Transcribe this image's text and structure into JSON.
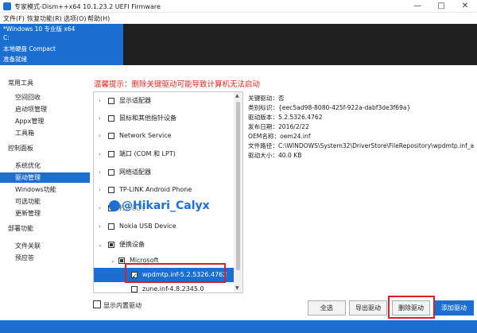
{
  "window": {
    "title": "专家模式-Dism++x64 10.1.23.2 UEFI Firmware",
    "minimize": "—",
    "maximize": "□",
    "close": "✕"
  },
  "menu": [
    "文件(F)",
    "恢复功能(R)",
    "选项(O)",
    "帮助(H)"
  ],
  "system": {
    "name": "*Windows 10 专业版 x64",
    "drive": "C:",
    "disk": "本地硬盘 Compact",
    "status": "准备就绪"
  },
  "sidebar": {
    "groups": [
      {
        "label": "常用工具",
        "items": [
          "空间回收",
          "启动项管理",
          "Appx管理",
          "工具箱"
        ]
      },
      {
        "label": "控制面板",
        "items": [
          "系统优化",
          "驱动管理",
          "Windows功能",
          "可选功能",
          "更新管理"
        ]
      },
      {
        "label": "部署功能",
        "items": [
          "文件关联",
          "预应答"
        ]
      }
    ],
    "active": "驱动管理"
  },
  "warning": "温馨提示：删除关键驱动可能导致计算机无法启动",
  "tree": [
    {
      "label": "显示适配器",
      "state": "none",
      "arrow": "›",
      "depth": 0
    },
    {
      "label": "鼠标和其他指针设备",
      "state": "none",
      "arrow": "›",
      "depth": 0
    },
    {
      "label": "Network Service",
      "state": "none",
      "arrow": "›",
      "depth": 0
    },
    {
      "label": "端口 (COM 和 LPT)",
      "state": "none",
      "arrow": "›",
      "depth": 0
    },
    {
      "label": "网络适配器",
      "state": "none",
      "arrow": "›",
      "depth": 0
    },
    {
      "label": "TP-LINK Android Phone",
      "state": "none",
      "arrow": "›",
      "depth": 0
    },
    {
      "label": "打印队列",
      "state": "none",
      "arrow": "›",
      "depth": 0
    },
    {
      "label": "Nokia USB Device",
      "state": "none",
      "arrow": "›",
      "depth": 0
    },
    {
      "label": "便携设备",
      "state": "partial",
      "arrow": "⌄",
      "depth": 0
    },
    {
      "label": "Microsoft",
      "state": "partial",
      "arrow": "⌄",
      "depth": 1
    },
    {
      "label": "wpdmtp.inf-5.2.5326.4762",
      "state": "checked",
      "arrow": "",
      "depth": 2,
      "selected": true
    },
    {
      "label": "zune.inf-4.8.2345.0",
      "state": "none",
      "arrow": "",
      "depth": 2
    }
  ],
  "details": {
    "critical": "关键驱动：否",
    "class_id": "类别标识：{eec5ad98-8080-425f-922a-dabf3de3f69a}",
    "version": "驱动版本：5.2.5326.4762",
    "date": "发布日期：2016/2/22",
    "oem_name": "OEM名称：oem24.inf",
    "path": "文件路径：C:\\WINDOWS\\System32\\DriverStore\\FileRepository\\wpdmtp.inf_a",
    "size": "驱动大小：40.0 KB"
  },
  "watermark": "@Hikari_Calyx",
  "show_builtin": "显示内置驱动",
  "buttons": {
    "select_all": "全选",
    "export": "导出驱动",
    "delete": "删除驱动",
    "add": "添加驱动"
  },
  "colors": {
    "accent": "#1b6fd1",
    "warning": "#e0261e",
    "highlight_box": "#d8202a"
  }
}
